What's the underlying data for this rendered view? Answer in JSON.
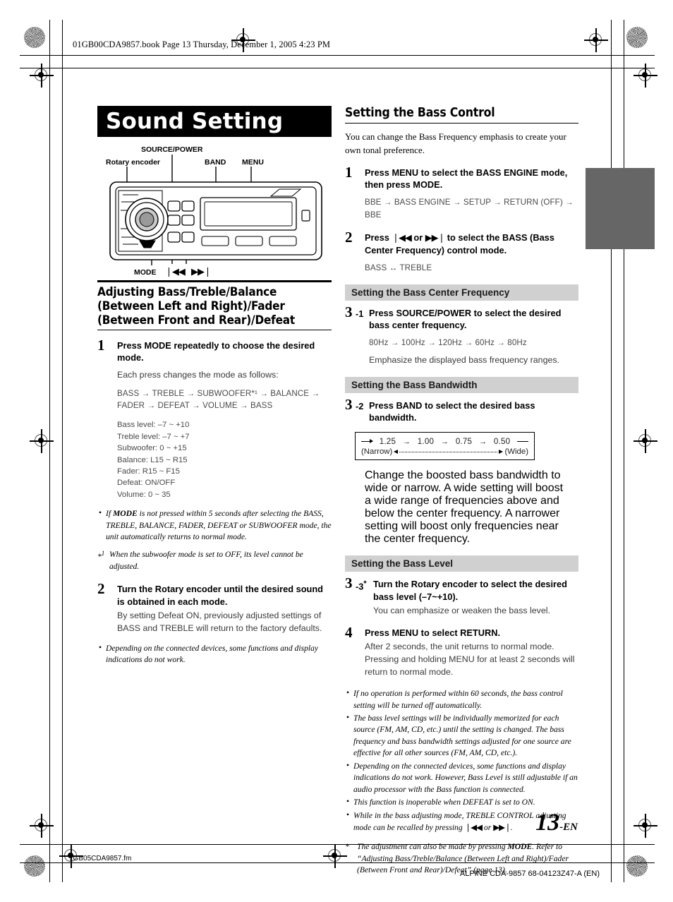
{
  "print_marks": {
    "running_header": "01GB00CDA9857.book  Page 13  Thursday, December 1, 2005  4:23 PM",
    "fm_filename": "1GB05CDA9857.fm",
    "footer_right": "ALPINE CDA-9857 68-04123Z47-A (EN)",
    "page_number": "13",
    "page_suffix": "-EN"
  },
  "banner": {
    "title": "Sound Setting"
  },
  "figure": {
    "labels": {
      "source_power": "SOURCE/POWER",
      "rotary_encoder": "Rotary encoder",
      "band": "BAND",
      "menu": "MENU",
      "mode": "MODE",
      "prev": "❘◀◀",
      "next": "▶▶❘"
    }
  },
  "left_column": {
    "heading": "Adjusting Bass/Treble/Balance (Between Left and Right)/Fader (Between Front and Rear)/Defeat",
    "step1": {
      "num": "1",
      "title_pre": "Press ",
      "title_key": "MODE",
      "title_post": " repeatedly to choose the desired mode.",
      "body": "Each press changes the mode as follows:",
      "chain": "BASS → TREBLE → SUBWOOFER*¹ → BALANCE → FADER → DEFEAT → VOLUME → BASS",
      "levels": [
        "Bass level: –7 ~ +10",
        "Treble level: –7 ~ +7",
        "Subwoofer: 0 ~ +15",
        "Balance: L15 ~ R15",
        "Fader: R15 ~ F15",
        "Defeat: ON/OFF",
        "Volume: 0 ~ 35"
      ]
    },
    "note1_pre": "If ",
    "note1_key": "MODE",
    "note1_post": " is not pressed within 5 seconds after selecting the BASS, TREBLE, BALANCE, FADER, DEFEAT or SUBWOOFER mode, the unit automatically returns to normal mode.",
    "footnote1_mark": "*1",
    "footnote1_text": "When the subwoofer mode is set to OFF, its level cannot be adjusted.",
    "step2": {
      "num": "2",
      "title_pre": "Turn the ",
      "title_key": "Rotary encoder",
      "title_post": " until the desired sound is obtained in each mode.",
      "body": "By setting Defeat ON, previously adjusted settings of BASS and TREBLE will return to the factory defaults."
    },
    "note2": "Depending on the connected devices, some functions and display indications do not work."
  },
  "right_column": {
    "heading": "Setting the Bass Control",
    "lead": "You can change the Bass Frequency emphasis to create your own tonal preference.",
    "step1": {
      "num": "1",
      "title_pre": "Press ",
      "title_key": "MENU",
      "title_mid": " to select the BASS ENGINE mode, then press ",
      "title_key2": "MODE",
      "title_post": ".",
      "chain": "BBE → BASS ENGINE → SETUP → RETURN (OFF) → BBE"
    },
    "step2": {
      "num": "2",
      "title_pre": "Press ",
      "title_key": "❘◀◀",
      "title_mid": " or ",
      "title_key2": "▶▶❘",
      "title_post": " to select the BASS (Bass Center Frequency) control mode.",
      "chain": "BASS ↔ TREBLE"
    },
    "sub1": "Setting the Bass Center Frequency",
    "step3_1": {
      "num": "3",
      "suffix": "-1",
      "title_pre": "Press ",
      "title_key": "SOURCE/POWER",
      "title_post": " to select the desired bass center frequency.",
      "chain": "80Hz → 100Hz → 120Hz → 60Hz → 80Hz",
      "body": "Emphasize the displayed bass frequency ranges."
    },
    "sub2": "Setting the Bass Bandwidth",
    "step3_2": {
      "num": "3",
      "suffix": "-2",
      "title_pre": "Press ",
      "title_key": "BAND",
      "title_post": " to select the desired bass bandwidth."
    },
    "bandwidth_diagram": {
      "values": [
        "1.25",
        "1.00",
        "0.75",
        "0.50"
      ],
      "arrow": "→",
      "left_label": "(Narrow)",
      "right_label": "(Wide)"
    },
    "bandwidth_note": "Change the boosted bass bandwidth to wide or narrow. A wide setting will boost a wide range of frequencies above and below the center frequency. A narrower setting will boost only frequencies near the center frequency.",
    "sub3": "Setting the Bass Level",
    "step3_3": {
      "num": "3",
      "suffix": "-3",
      "star": "*",
      "title_pre": "Turn the ",
      "title_key": "Rotary encoder",
      "title_post": " to select the desired bass level (–7~+10).",
      "body": "You can emphasize or weaken the bass level."
    },
    "step4": {
      "num": "4",
      "title_pre": "Press ",
      "title_key": "MENU",
      "title_post": " to select RETURN.",
      "body_line1": "After 2 seconds, the unit returns to normal mode.",
      "body_line2_pre": "Pressing and holding ",
      "body_line2_key": "MENU",
      "body_line2_post": " for at least 2 seconds will return to normal mode."
    },
    "notes": [
      "If no operation is performed within 60 seconds, the bass control setting will be turned off automatically.",
      "The bass level settings will be individually memorized for each source (FM, AM, CD, etc.) until the setting is changed. The bass frequency and bass bandwidth settings adjusted for one source are effective for all other sources (FM, AM, CD, etc.).",
      "Depending on the connected devices, some functions and display indications do not work. However, Bass Level is still adjustable if an audio processor with the Bass function is connected.",
      "This function is inoperable when DEFEAT is set to ON."
    ],
    "note_treble_pre": "While in the bass adjusting mode, TREBLE CONTROL adjusting mode can be recalled by pressing ",
    "note_treble_key1": "❘◀◀",
    "note_treble_mid": " or ",
    "note_treble_key2": "▶▶❘",
    "note_treble_post": ".",
    "star_footnote_mark": "*",
    "star_footnote_pre": "The adjustment can also be made by pressing ",
    "star_footnote_key": "MODE",
    "star_footnote_post": ". Refer to “Adjusting Bass/Treble/Balance (Between Left and Right)/Fader (Between Front and Rear)/Defeat” (page 13)."
  }
}
